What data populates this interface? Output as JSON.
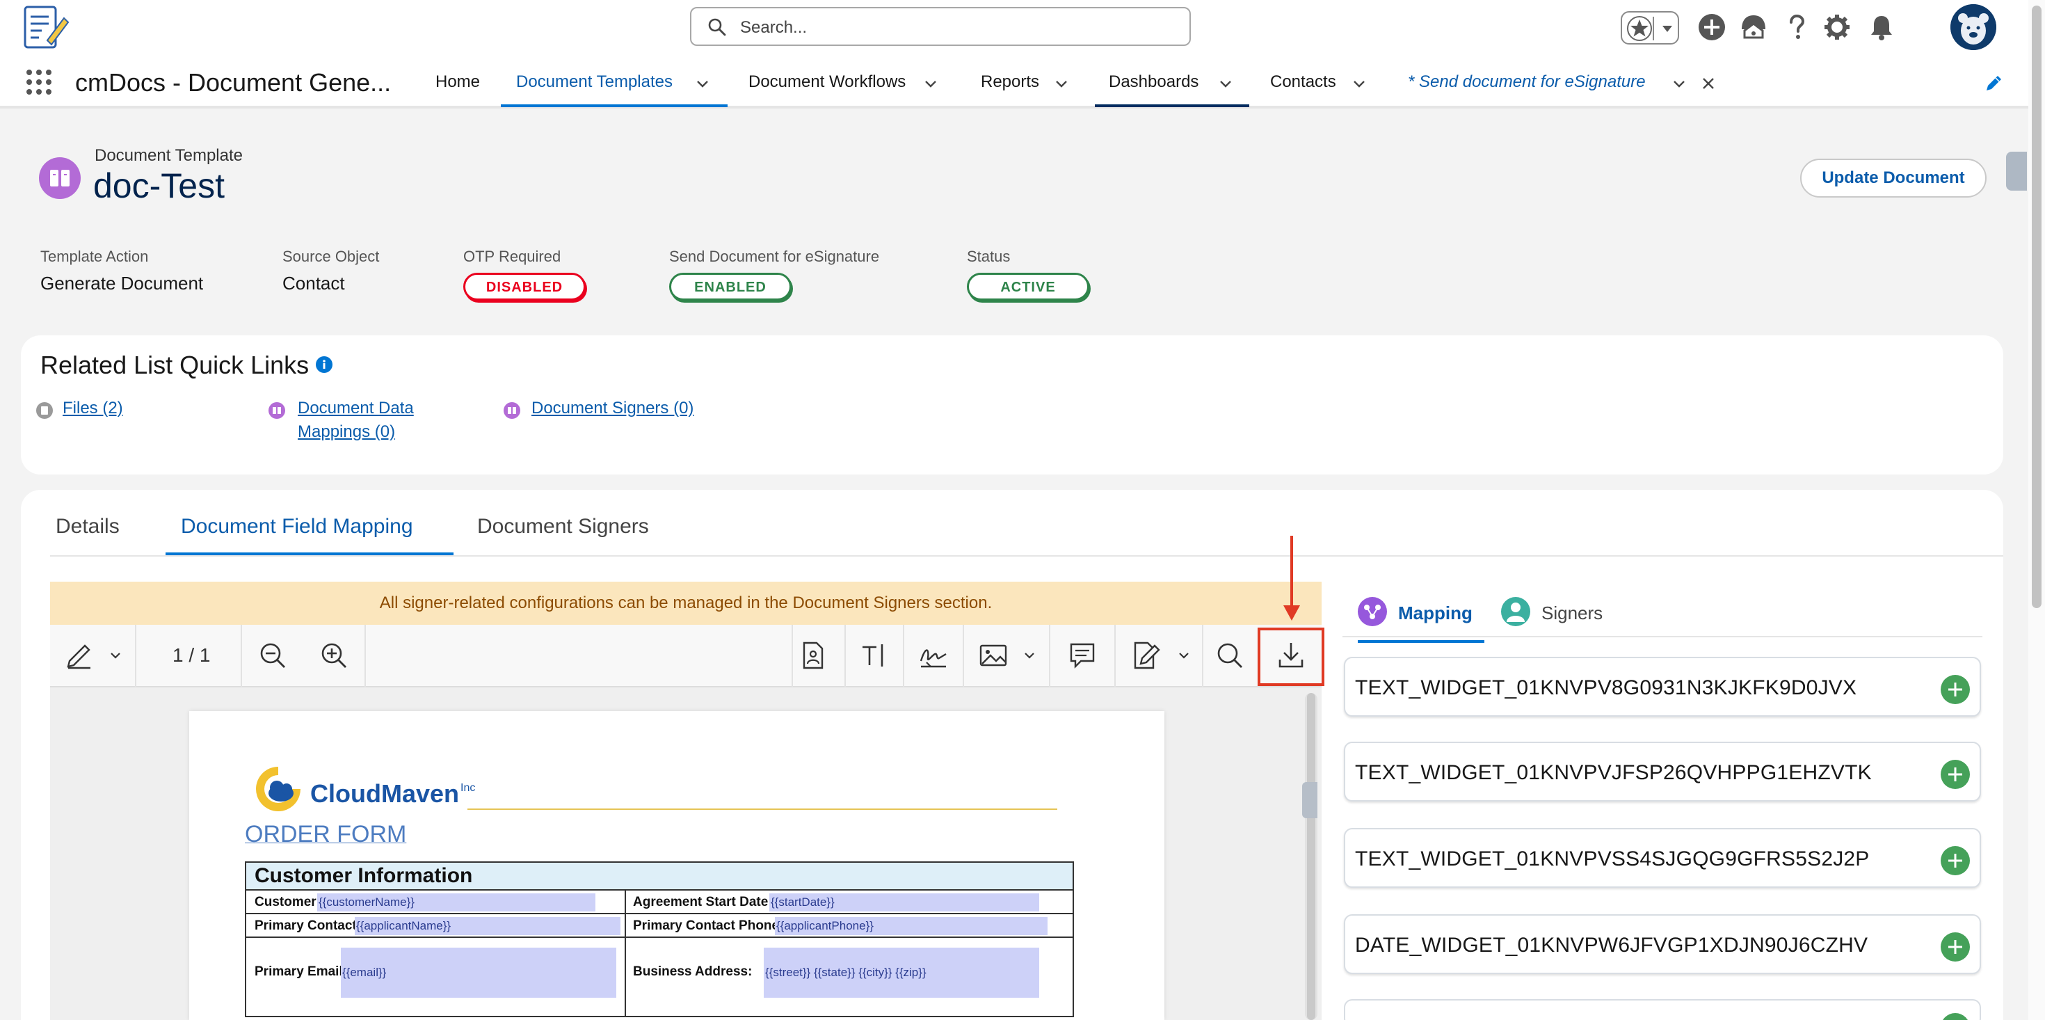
{
  "header": {
    "search_placeholder": "Search...",
    "icons": [
      "favorites-star-icon",
      "chevron-down-icon",
      "add-icon",
      "trailhead-icon",
      "help-icon",
      "setup-gear-icon",
      "notifications-bell-icon",
      "user-avatar"
    ]
  },
  "nav": {
    "app_name": "cmDocs - Document Gene...",
    "items": [
      {
        "label": "Home"
      },
      {
        "label": "Document Templates"
      },
      {
        "label": "Document Workflows"
      },
      {
        "label": "Reports"
      },
      {
        "label": "Dashboards"
      },
      {
        "label": "Contacts"
      },
      {
        "label": "* Send document for eSignature"
      }
    ]
  },
  "record": {
    "type_label": "Document Template",
    "name": "doc-Test",
    "update_button": "Update Document",
    "fields": [
      {
        "label": "Template Action",
        "value": "Generate Document"
      },
      {
        "label": "Source Object",
        "value": "Contact"
      },
      {
        "label": "OTP Required",
        "value": "DISABLED"
      },
      {
        "label": "Send Document for eSignature",
        "value": "ENABLED"
      },
      {
        "label": "Status",
        "value": "ACTIVE"
      }
    ]
  },
  "related": {
    "title": "Related List Quick Links",
    "links": [
      {
        "label": "Files (2)"
      },
      {
        "label": "Document Data Mappings (0)"
      },
      {
        "label": "Document Signers (0)"
      }
    ]
  },
  "tabs": {
    "items": [
      {
        "label": "Details"
      },
      {
        "label": "Document Field Mapping"
      },
      {
        "label": "Document Signers"
      }
    ]
  },
  "viewer": {
    "banner": "All signer-related configurations can be managed in the Document Signers section.",
    "page_count": "1 / 1",
    "toolbar_icons": [
      "annotate-pen-icon",
      "zoom-out-icon",
      "zoom-in-icon",
      "form-field-icon",
      "text-field-icon",
      "signature-icon",
      "image-icon",
      "comment-icon",
      "edit-sign-icon",
      "search-icon",
      "download-icon"
    ]
  },
  "document": {
    "brand": "CloudMaven",
    "brand_suffix": "Inc",
    "title": "ORDER FORM",
    "section": "Customer Information",
    "rows": [
      {
        "l1": "Customer:",
        "t1": "{{customerName}}",
        "l2": "Agreement Start Date:",
        "t2": "{{startDate}}"
      },
      {
        "l1": "Primary Contact:",
        "t1": "{{applicantName}}",
        "l2": "Primary Contact Phone:",
        "t2": "{{applicantPhone}}"
      },
      {
        "l1": "Primary Email:",
        "t1": "{{email}}",
        "l2": "Business Address:",
        "t2": "{{street}} {{state}} {{city}} {{zip}}"
      }
    ]
  },
  "panel": {
    "tabs": [
      {
        "label": "Mapping"
      },
      {
        "label": "Signers"
      }
    ],
    "widgets": [
      {
        "name": "TEXT_WIDGET_01KNVPV8G0931N3KJKFK9D0JVX"
      },
      {
        "name": "TEXT_WIDGET_01KNVPVJFSP26QVHPPG1EHZVTK"
      },
      {
        "name": "TEXT_WIDGET_01KNVPVSS4SJGQG9GFRS5S2J2P"
      },
      {
        "name": "DATE_WIDGET_01KNVPW6JFVGP1XDJN90J6CZHV"
      }
    ]
  },
  "colors": {
    "brand_blue": "#0176d3",
    "link_blue": "#0b5cab",
    "disabled_red": "#ea001e",
    "enabled_green": "#2e844a",
    "highlight_red": "#e03a24",
    "banner_bg": "#fbe6bd"
  }
}
